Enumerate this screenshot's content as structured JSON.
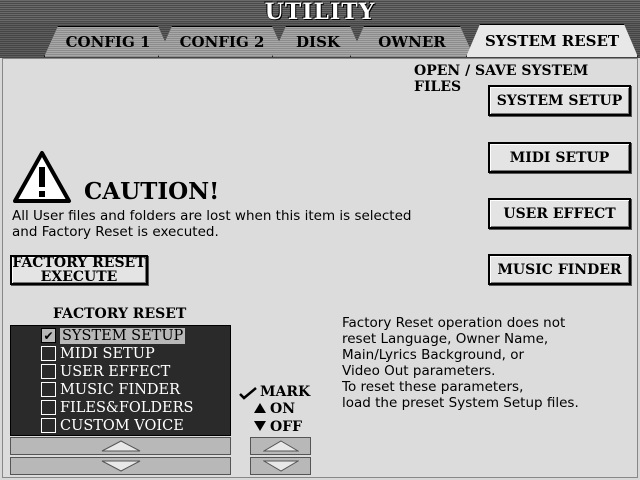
{
  "title": "UTILITY",
  "tabs": [
    {
      "label": "CONFIG 1"
    },
    {
      "label": "CONFIG 2"
    },
    {
      "label": "DISK"
    },
    {
      "label": "OWNER"
    },
    {
      "label": "SYSTEM RESET"
    }
  ],
  "open_save": {
    "heading": "OPEN / SAVE SYSTEM FILES",
    "buttons": [
      {
        "label": "SYSTEM SETUP"
      },
      {
        "label": "MIDI SETUP"
      },
      {
        "label": "USER EFFECT"
      },
      {
        "label": "MUSIC FINDER"
      }
    ]
  },
  "caution": {
    "title": "CAUTION!",
    "line1": "All User files and folders are lost when this item is selected",
    "line2": "and Factory Reset is executed.",
    "icon": "warning-triangle-icon"
  },
  "factory_reset_execute": {
    "line1": "FACTORY RESET",
    "line2": "EXECUTE"
  },
  "factory_reset": {
    "heading": "FACTORY RESET",
    "items": [
      {
        "label": "SYSTEM SETUP",
        "checked": true,
        "selected": true
      },
      {
        "label": "MIDI SETUP",
        "checked": false,
        "selected": false
      },
      {
        "label": "USER EFFECT",
        "checked": false,
        "selected": false
      },
      {
        "label": "MUSIC FINDER",
        "checked": false,
        "selected": false
      },
      {
        "label": "FILES&FOLDERS",
        "checked": false,
        "selected": false
      },
      {
        "label": "CUSTOM VOICE",
        "checked": false,
        "selected": false
      }
    ]
  },
  "mark": {
    "mark": "MARK",
    "on": "ON",
    "off": "OFF"
  },
  "info": {
    "lines": [
      "Factory Reset operation does not",
      "reset Language, Owner Name,",
      "Main/Lyrics Background, or",
      "Video Out parameters.",
      "To reset these parameters,",
      "load the preset System Setup files."
    ]
  },
  "colors": {
    "list_bg": "#2a2a2a",
    "selected_bg": "#b8b8b8",
    "panel_bg": "#dcdcdc"
  }
}
